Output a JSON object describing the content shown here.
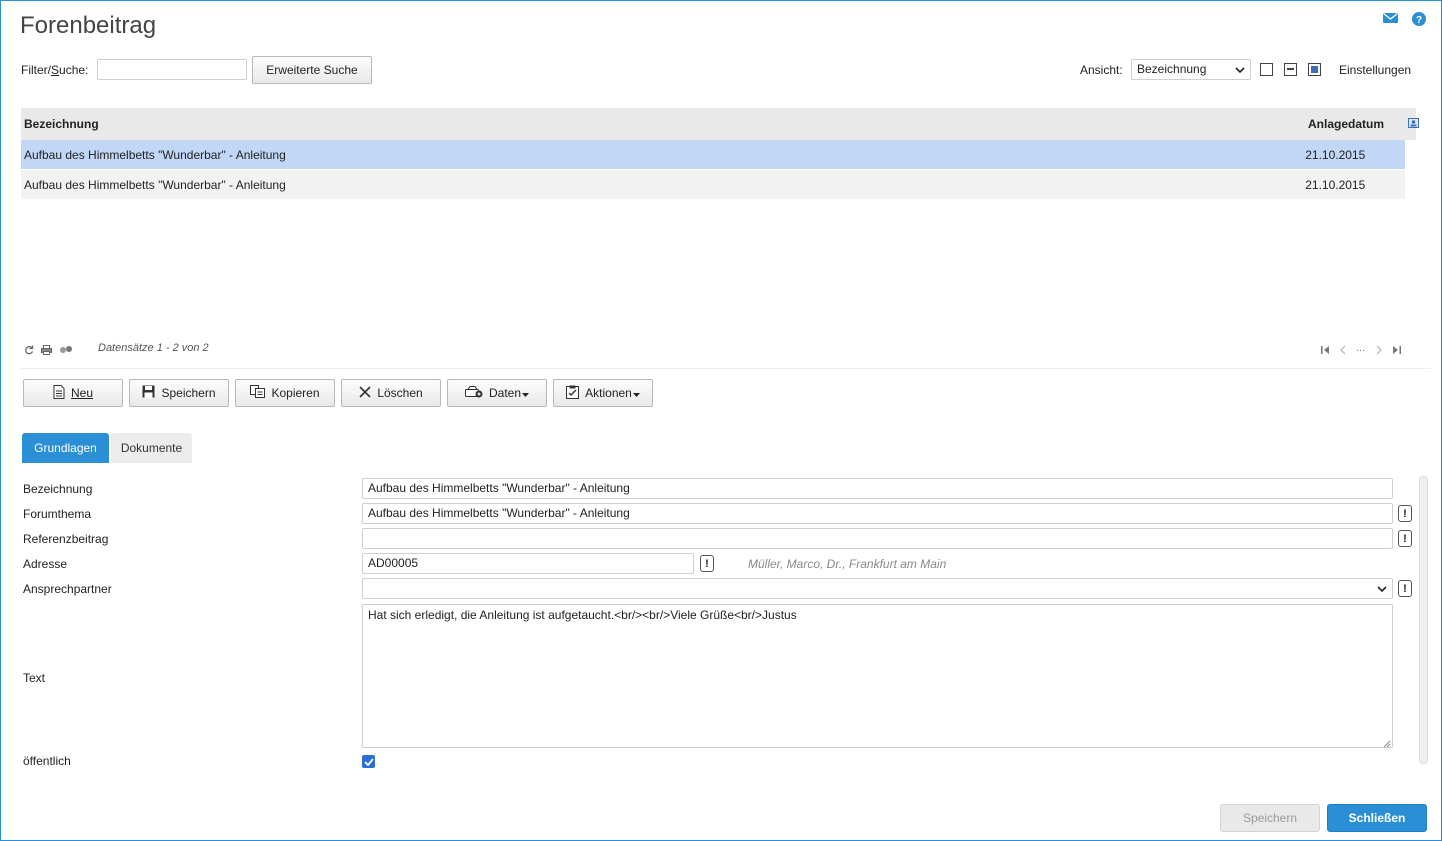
{
  "page": {
    "title": "Forenbeitrag"
  },
  "colors": {
    "accent": "#2b8fd6",
    "selected_row": "#c2d7f5",
    "header_bg": "#e9e9e9"
  },
  "top_icons": [
    "mail-icon",
    "help-icon"
  ],
  "search": {
    "label": "Filter/Suche:",
    "value": "",
    "placeholder": "",
    "advanced_button": "Erweiterte Suche"
  },
  "view": {
    "label": "Ansicht:",
    "selected": "Bezeichnung",
    "settings": "Einstellungen"
  },
  "grid": {
    "columns": [
      "Bezeichnung",
      "Anlagedatum"
    ],
    "rows": [
      {
        "bezeichnung": "Aufbau des Himmelbetts \"Wunderbar\" - Anleitung",
        "anlagedatum": "21.10.2015",
        "selected": true
      },
      {
        "bezeichnung": "Aufbau des Himmelbetts \"Wunderbar\" - Anleitung",
        "anlagedatum": "21.10.2015",
        "selected": false
      }
    ],
    "records": "Datensätze 1 - 2 von 2",
    "pager_ellipsis": "..."
  },
  "toolbar": {
    "new": "Neu",
    "save": "Speichern",
    "copy": "Kopieren",
    "delete": "Löschen",
    "data": "Daten",
    "actions": "Aktionen"
  },
  "tabs": [
    {
      "label": "Grundlagen",
      "active": true
    },
    {
      "label": "Dokumente",
      "active": false
    }
  ],
  "form": {
    "bezeichnung": {
      "label": "Bezeichnung",
      "value": "Aufbau des Himmelbetts \"Wunderbar\" - Anleitung"
    },
    "forumthema": {
      "label": "Forumthema",
      "value": "Aufbau des Himmelbetts \"Wunderbar\" - Anleitung"
    },
    "referenzbeitrag": {
      "label": "Referenzbeitrag",
      "value": ""
    },
    "adresse": {
      "label": "Adresse",
      "value": "AD00005",
      "info": "Müller, Marco, Dr., Frankfurt am Main"
    },
    "ansprechpartner": {
      "label": "Ansprechpartner",
      "value": ""
    },
    "text": {
      "label": "Text",
      "value": "Hat sich erledigt, die Anleitung ist aufgetaucht.<br/><br/>Viele Grüße<br/>Justus"
    },
    "oeffentlich": {
      "label": "öffentlich",
      "checked": true
    }
  },
  "footer": {
    "save": "Speichern",
    "close": "Schließen"
  },
  "excl_symbol": "!"
}
